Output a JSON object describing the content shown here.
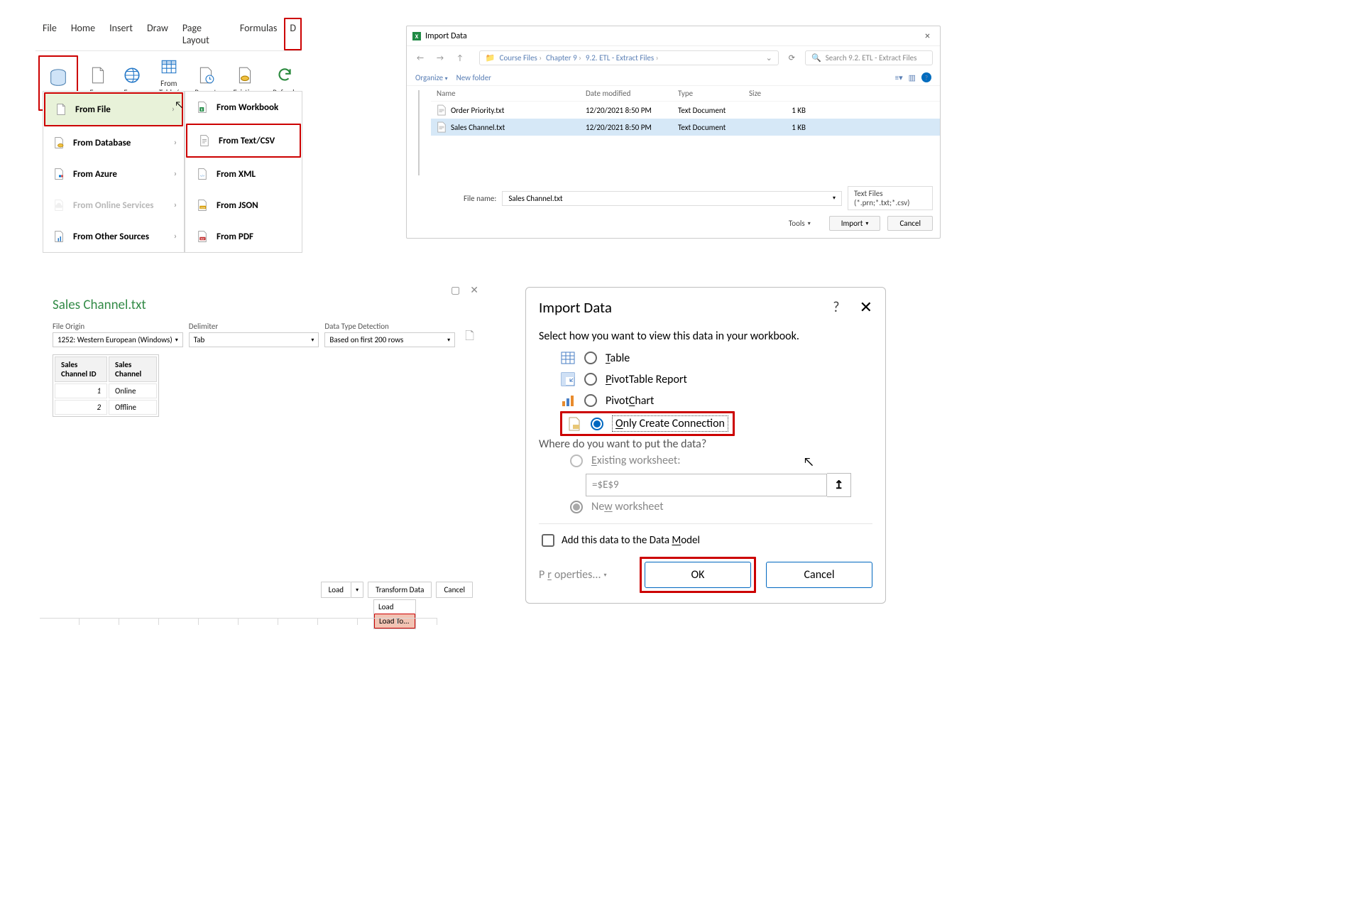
{
  "ribbon": {
    "tabs": [
      "File",
      "Home",
      "Insert",
      "Draw",
      "Page Layout",
      "Formulas",
      "D"
    ],
    "buttons": {
      "get_data": "Get\nData",
      "text_csv": "From\nText/CSV",
      "web": "From\nWeb",
      "table_range": "From Table/\nRange",
      "recent": "Recent\nSources",
      "existing": "Existing\nConnections",
      "refresh": "Refresh\nAll"
    }
  },
  "flyout1": {
    "from_file": "From File",
    "from_db": "From Database",
    "from_azure": "From Azure",
    "from_online": "From Online Services",
    "from_other": "From Other Sources"
  },
  "flyout2": {
    "workbook": "From Workbook",
    "textcsv": "From Text/CSV",
    "xml": "From XML",
    "json": "From JSON",
    "pdf": "From PDF"
  },
  "file_dialog": {
    "title": "Import Data",
    "path": [
      "Course Files",
      "Chapter 9",
      "9.2. ETL - Extract Files"
    ],
    "search_placeholder": "Search 9.2. ETL - Extract Files",
    "organize": "Organize",
    "new_folder": "New folder",
    "cols": [
      "Name",
      "Date modified",
      "Type",
      "Size"
    ],
    "rows": [
      {
        "name": "Order Priority.txt",
        "date": "12/20/2021 8:50 PM",
        "type": "Text Document",
        "size": "1 KB"
      },
      {
        "name": "Sales Channel.txt",
        "date": "12/20/2021 8:50 PM",
        "type": "Text Document",
        "size": "1 KB"
      }
    ],
    "file_name_label": "File name:",
    "file_name_value": "Sales Channel.txt",
    "filter": "Text Files (*.prn;*.txt;*.csv)",
    "tools": "Tools",
    "import": "Import",
    "cancel": "Cancel"
  },
  "preview": {
    "title": "Sales Channel.txt",
    "origin_label": "File Origin",
    "origin_value": "1252: Western European (Windows)",
    "delim_label": "Delimiter",
    "delim_value": "Tab",
    "detect_label": "Data Type Detection",
    "detect_value": "Based on first 200 rows",
    "cols": [
      "Sales Channel ID",
      "Sales Channel"
    ],
    "rows": [
      {
        "id": "1",
        "name": "Online"
      },
      {
        "id": "2",
        "name": "Offline"
      }
    ],
    "load": "Load",
    "transform": "Transform Data",
    "cancel": "Cancel",
    "dd_load": "Load",
    "dd_load_to": "Load To..."
  },
  "import_data": {
    "title": "Import Data",
    "instruction": "Select how you want to view this data in your workbook.",
    "opt_table": "Table",
    "opt_pivot": "PivotTable Report",
    "opt_chart": "PivotChart",
    "opt_conn": "Only Create Connection",
    "where": "Where do you want to put the data?",
    "existing_ws": "Existing worksheet:",
    "range": "=$E$9",
    "new_ws": "New worksheet",
    "add_model": "Add this data to the Data Model",
    "properties": "Properties...",
    "ok": "OK",
    "cancel": "Cancel"
  }
}
